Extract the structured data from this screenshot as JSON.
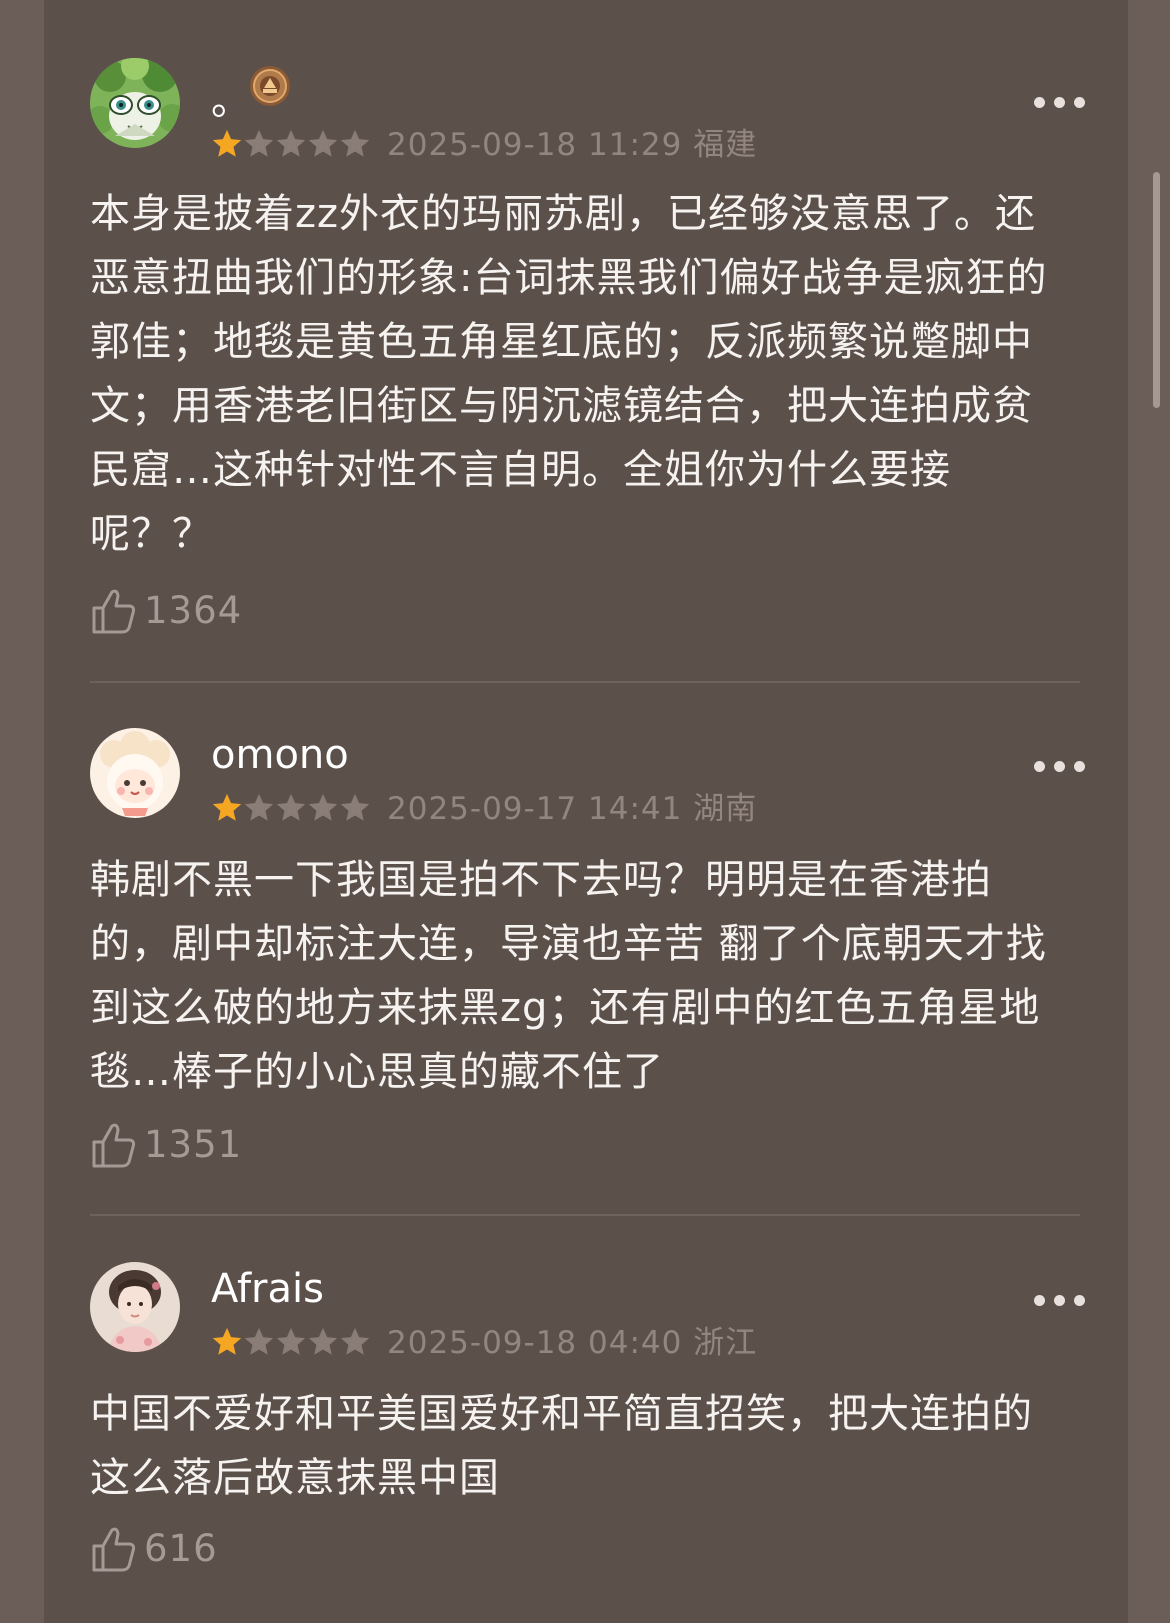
{
  "reviews": [
    {
      "username": "。",
      "rating": 1,
      "rating_max": 5,
      "date": "2025-09-18 11:29",
      "location": "福建",
      "text": "本身是披着zz外衣的玛丽苏剧，已经够没意思了。还恶意扭曲我们的形象:台词抹黑我们偏好战争是疯狂的郭佳；地毯是黄色五角星红底的；反派频繁说蹩脚中文；用香港老旧街区与阴沉滤镜结合，把大连拍成贫民窟…这种针对性不言自明。全姐你为什么要接呢？？",
      "likes": "1364",
      "avatar_icon": "avatar-green-creature",
      "has_badge": true,
      "badge_icon": "medal-badge-icon"
    },
    {
      "username": "omono",
      "rating": 1,
      "rating_max": 5,
      "date": "2025-09-17 14:41",
      "location": "湖南",
      "text": "韩剧不黑一下我国是拍不下去吗？明明是在香港拍的，剧中却标注大连，导演也辛苦 翻了个底朝天才找到这么破的地方来抹黑zg；还有剧中的红色五角星地毯…棒子的小心思真的藏不住了",
      "likes": "1351",
      "avatar_icon": "avatar-sheep-cartoon",
      "has_badge": false
    },
    {
      "username": "Afrais",
      "rating": 1,
      "rating_max": 5,
      "date": "2025-09-18 04:40",
      "location": "浙江",
      "text": "中国不爱好和平美国爱好和平简直招笑，把大连拍的这么落后故意抹黑中国",
      "likes": "616",
      "avatar_icon": "avatar-portrait-woman",
      "has_badge": false
    }
  ],
  "colors": {
    "star_filled": "#f5a623",
    "star_empty": "#8a7d77",
    "panel_bg": "#5c504b",
    "outer_bg": "#6b5e58"
  }
}
